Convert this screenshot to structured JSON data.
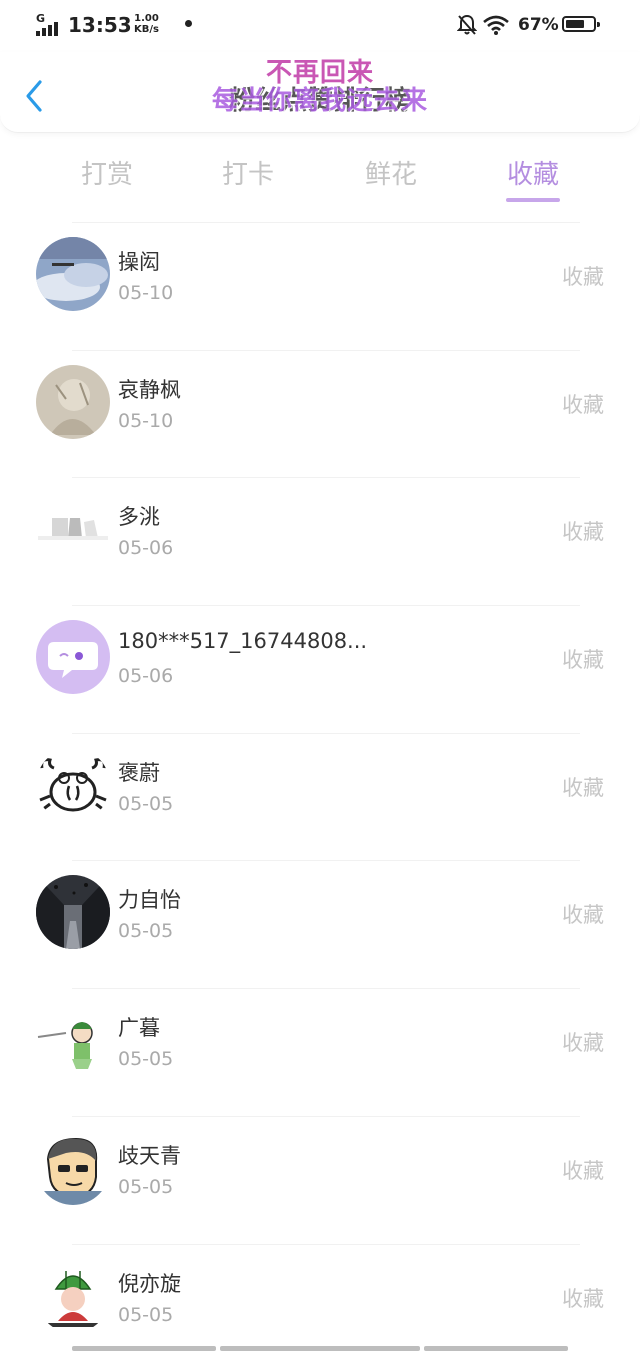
{
  "status_bar": {
    "network": "G",
    "time": "13:53",
    "speed_value": "1.00",
    "speed_unit": "KB/s",
    "battery": "67%"
  },
  "header": {
    "title": "粉丝点赞排行榜",
    "overlay_line1": "不再回来",
    "overlay_line2": "每当你离我远去来"
  },
  "tabs": [
    {
      "label": "打赏",
      "active": false
    },
    {
      "label": "打卡",
      "active": false
    },
    {
      "label": "鲜花",
      "active": false
    },
    {
      "label": "收藏",
      "active": true
    }
  ],
  "list": [
    {
      "name": "操闳",
      "date": "05-10",
      "action": "收藏",
      "avatar": "sky-photo"
    },
    {
      "name": "哀静枫",
      "date": "05-10",
      "action": "收藏",
      "avatar": "sketch-photo"
    },
    {
      "name": "多洮",
      "date": "05-06",
      "action": "收藏",
      "avatar": "landscape-photo"
    },
    {
      "name": "180***517_16744808...",
      "date": "05-06",
      "action": "收藏",
      "avatar": "chat-bubble-icon"
    },
    {
      "name": "褒蔚",
      "date": "05-05",
      "action": "收藏",
      "avatar": "crab-drawing"
    },
    {
      "name": "力自怡",
      "date": "05-05",
      "action": "收藏",
      "avatar": "dark-street-photo"
    },
    {
      "name": "广暮",
      "date": "05-05",
      "action": "收藏",
      "avatar": "cartoon-girl"
    },
    {
      "name": "歧天青",
      "date": "05-05",
      "action": "收藏",
      "avatar": "cartoon-man"
    },
    {
      "name": "倪亦旋",
      "date": "05-05",
      "action": "收藏",
      "avatar": "watermelon-cartoon"
    }
  ],
  "colors": {
    "accent": "#b48ee0",
    "back": "#2a9be8",
    "muted": "#c6c6c6"
  }
}
